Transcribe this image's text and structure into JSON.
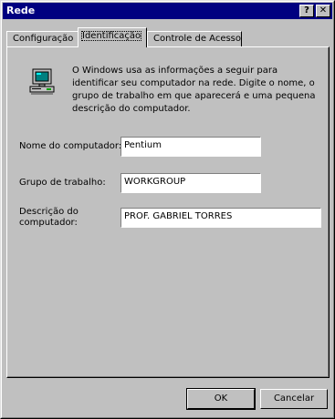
{
  "window": {
    "title": "Rede",
    "help_glyph": "?",
    "close_glyph": "✕"
  },
  "tabs": [
    {
      "label": "Configuração",
      "active": false
    },
    {
      "label": "Identificação",
      "active": true
    },
    {
      "label": "Controle de Acesso",
      "active": false
    }
  ],
  "identification": {
    "icon": "computer-icon",
    "info_text": "O Windows usa as informações a seguir para identificar seu computador na rede. Digite o nome, o grupo de trabalho em que aparecerá e uma pequena descrição do computador.",
    "computer_name_label": "Nome do computador:",
    "computer_name_value": "Pentium",
    "workgroup_label": "Grupo de trabalho:",
    "workgroup_value": "WORKGROUP",
    "description_label_line1": "Descrição do",
    "description_label_line2": "computador:",
    "description_value": "PROF. GABRIEL TORRES"
  },
  "buttons": {
    "ok_label": "OK",
    "cancel_label": "Cancelar"
  },
  "colors": {
    "titlebar": "#000080",
    "face": "#c0c0c0"
  }
}
